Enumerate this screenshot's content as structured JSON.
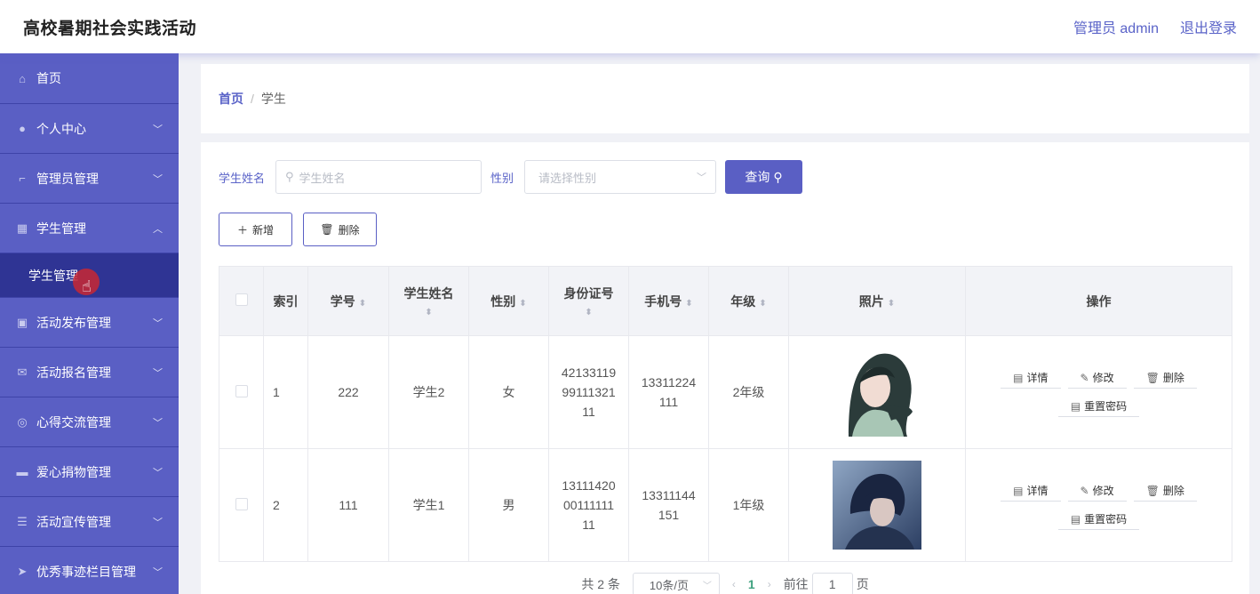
{
  "header": {
    "title": "高校暑期社会实践活动",
    "user_label": "管理员 admin",
    "logout_label": "退出登录"
  },
  "sidebar": {
    "items": [
      {
        "label": "首页",
        "icon": "home-icon",
        "chevron": ""
      },
      {
        "label": "个人中心",
        "icon": "user-icon",
        "chevron": "﹀"
      },
      {
        "label": "管理员管理",
        "icon": "crop-icon",
        "chevron": "﹀"
      },
      {
        "label": "学生管理",
        "icon": "grid-icon",
        "chevron": "︿"
      },
      {
        "label": "活动发布管理",
        "icon": "image-icon",
        "chevron": "﹀"
      },
      {
        "label": "活动报名管理",
        "icon": "mail-icon",
        "chevron": "﹀"
      },
      {
        "label": "心得交流管理",
        "icon": "compass-icon",
        "chevron": "﹀"
      },
      {
        "label": "爱心捐物管理",
        "icon": "film-icon",
        "chevron": "﹀"
      },
      {
        "label": "活动宣传管理",
        "icon": "sliders-icon",
        "chevron": "﹀"
      },
      {
        "label": "优秀事迹栏目管理",
        "icon": "send-icon",
        "chevron": "﹀"
      }
    ],
    "submenu": {
      "label": "学生管理"
    }
  },
  "breadcrumb": {
    "home": "首页",
    "separator": "/",
    "current": "学生"
  },
  "search": {
    "name_label": "学生姓名",
    "name_placeholder": "学生姓名",
    "gender_label": "性别",
    "gender_placeholder": "请选择性别",
    "query_label": "查询"
  },
  "actions": {
    "add_label": "新增",
    "delete_label": "删除"
  },
  "table": {
    "headers": {
      "index": "索引",
      "student_no": "学号",
      "name": "学生姓名",
      "gender": "性别",
      "id_card": "身份证号",
      "phone": "手机号",
      "grade": "年级",
      "photo": "照片",
      "ops": "操作"
    },
    "rows": [
      {
        "index": "1",
        "student_no": "222",
        "name": "学生2",
        "gender": "女",
        "id_card": [
          "42133119",
          "99111321",
          "11"
        ],
        "phone": [
          "13311224",
          "111"
        ],
        "grade": "2年级"
      },
      {
        "index": "2",
        "student_no": "111",
        "name": "学生1",
        "gender": "男",
        "id_card": [
          "13111420",
          "00111111",
          "11"
        ],
        "phone": [
          "13311144",
          "151"
        ],
        "grade": "1年级"
      }
    ],
    "op_labels": {
      "detail": "详情",
      "edit": "修改",
      "delete": "删除",
      "reset": "重置密码"
    }
  },
  "pagination": {
    "total": "共 2 条",
    "page_size": "10条/页",
    "current_page": "1",
    "goto_prefix": "前往",
    "goto_value": "1",
    "goto_suffix": "页"
  },
  "colors": {
    "accent": "#5a5fc4",
    "sidebar_active": "#2f3494",
    "link": "#5a63c8"
  }
}
